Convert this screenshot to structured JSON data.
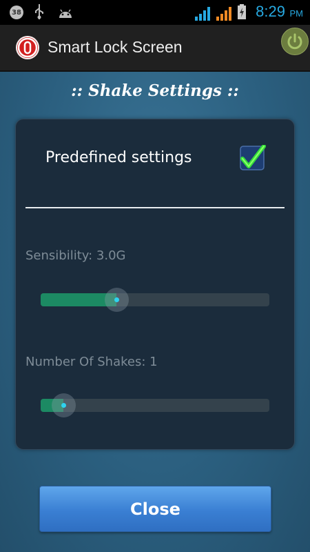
{
  "status_bar": {
    "notification_badge": "38",
    "icons": [
      "usb-icon",
      "android-icon",
      "signal-blue-icon",
      "signal-orange-icon",
      "battery-charging-icon"
    ],
    "time": "8:29",
    "ampm": "PM",
    "accent_color": "#27a9e1"
  },
  "app_bar": {
    "title": "Smart Lock Screen",
    "app_icon": "power-icon",
    "action_icon": "power-button-icon"
  },
  "heading": ":: Shake Settings ::",
  "panel": {
    "predefined_label": "Predefined settings",
    "predefined_checked": true,
    "sensibility": {
      "label": "Sensibility: 3.0G",
      "slider_fraction": 0.33
    },
    "shakes": {
      "label": "Number Of Shakes: 1",
      "slider_fraction": 0.1
    }
  },
  "close_button": {
    "label": "Close"
  },
  "colors": {
    "background": "#2b5f7f",
    "panel": "#1b2c3c",
    "slider_fill": "#1c8a63",
    "button": "#3a7fd3"
  }
}
